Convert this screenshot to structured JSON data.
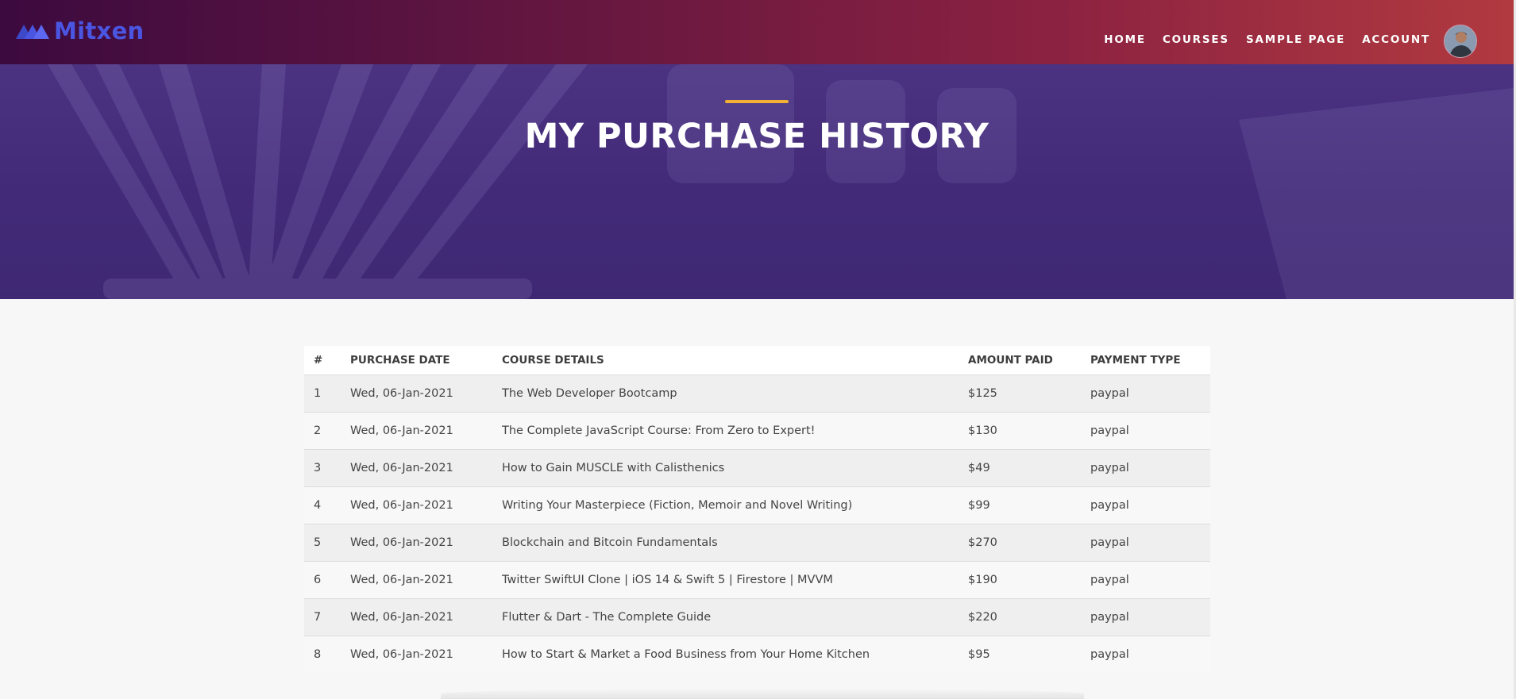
{
  "brand": {
    "name": "Mitxen"
  },
  "nav": {
    "items": [
      {
        "label": "HOME"
      },
      {
        "label": "COURSES"
      },
      {
        "label": "SAMPLE PAGE"
      },
      {
        "label": "ACCOUNT"
      }
    ]
  },
  "hero": {
    "title": "MY PURCHASE HISTORY"
  },
  "table": {
    "headers": {
      "num": "#",
      "date": "PURCHASE DATE",
      "course": "COURSE DETAILS",
      "amount": "AMOUNT PAID",
      "payment": "PAYMENT TYPE"
    },
    "rows": [
      {
        "num": "1",
        "date": "Wed, 06-Jan-2021",
        "course": "The Web Developer Bootcamp",
        "amount": "$125",
        "payment": "paypal"
      },
      {
        "num": "2",
        "date": "Wed, 06-Jan-2021",
        "course": "The Complete JavaScript Course: From Zero to Expert!",
        "amount": "$130",
        "payment": "paypal"
      },
      {
        "num": "3",
        "date": "Wed, 06-Jan-2021",
        "course": "How to Gain MUSCLE with Calisthenics",
        "amount": "$49",
        "payment": "paypal"
      },
      {
        "num": "4",
        "date": "Wed, 06-Jan-2021",
        "course": "Writing Your Masterpiece (Fiction, Memoir and Novel Writing)",
        "amount": "$99",
        "payment": "paypal"
      },
      {
        "num": "5",
        "date": "Wed, 06-Jan-2021",
        "course": "Blockchain and Bitcoin Fundamentals",
        "amount": "$270",
        "payment": "paypal"
      },
      {
        "num": "6",
        "date": "Wed, 06-Jan-2021",
        "course": "Twitter SwiftUI Clone | iOS 14 & Swift 5 | Firestore | MVVM",
        "amount": "$190",
        "payment": "paypal"
      },
      {
        "num": "7",
        "date": "Wed, 06-Jan-2021",
        "course": "Flutter & Dart - The Complete Guide",
        "amount": "$220",
        "payment": "paypal"
      },
      {
        "num": "8",
        "date": "Wed, 06-Jan-2021",
        "course": "How to Start & Market a Food Business from Your Home Kitchen",
        "amount": "$95",
        "payment": "paypal"
      }
    ]
  },
  "colors": {
    "accent": "#f2b134",
    "brand_blue": "#4a56e2",
    "hero_purple": "#422a78",
    "header_gradient_start": "#3c0a3f",
    "header_gradient_end": "#b13a40"
  }
}
